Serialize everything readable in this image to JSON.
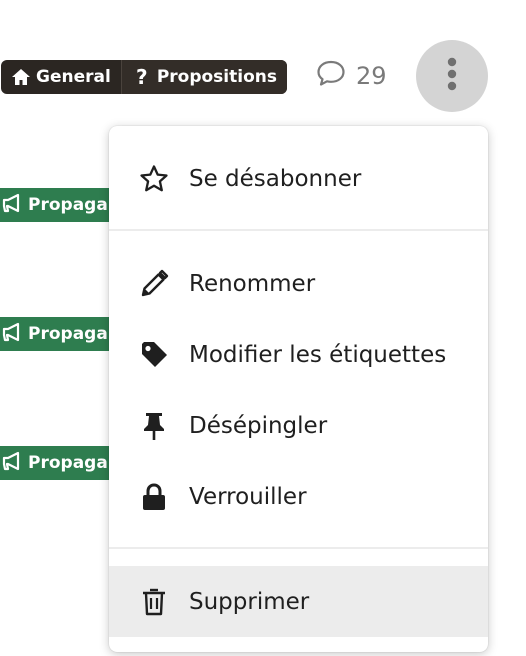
{
  "breadcrumbs": [
    {
      "label": "General",
      "icon": "home-icon"
    },
    {
      "label": "Propositions",
      "icon": "question-icon"
    }
  ],
  "comments": {
    "count": "29",
    "icon": "comment-icon"
  },
  "more_button": {
    "icon": "ellipsis-vertical-icon"
  },
  "tags": [
    {
      "label": "Propagan",
      "icon": "megaphone-icon"
    },
    {
      "label": "Propagan",
      "icon": "megaphone-icon"
    },
    {
      "label": "Propagan",
      "icon": "megaphone-icon"
    }
  ],
  "menu": {
    "items": [
      {
        "label": "Se désabonner",
        "icon": "star-outline-icon"
      },
      {
        "label": "Renommer",
        "icon": "pencil-icon"
      },
      {
        "label": "Modifier les étiquettes",
        "icon": "tag-icon"
      },
      {
        "label": "Désépingler",
        "icon": "pin-icon"
      },
      {
        "label": "Verrouiller",
        "icon": "lock-icon"
      },
      {
        "label": "Supprimer",
        "icon": "trash-icon"
      }
    ]
  },
  "colors": {
    "breadcrumb_bg": "#2b2622",
    "tag_bg": "#2e7d4f",
    "more_button_bg": "#d4d4d4",
    "menu_hover_bg": "#ececec"
  }
}
